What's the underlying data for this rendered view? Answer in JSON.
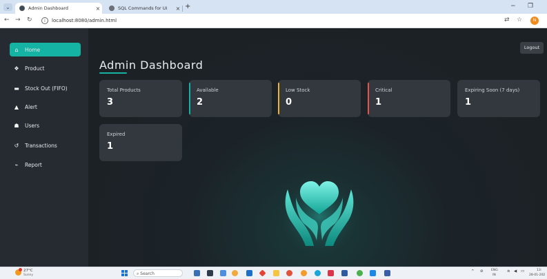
{
  "browser": {
    "tabs": [
      {
        "title": "Admin Dashboard",
        "active": true
      },
      {
        "title": "SQL Commands for UI",
        "active": false
      }
    ],
    "url": "localhost:8080/admin.html"
  },
  "sidebar": {
    "items": [
      {
        "label": "Home",
        "icon": "home-icon",
        "glyph": "⌂",
        "active": true
      },
      {
        "label": "Product",
        "icon": "product-icon",
        "glyph": "❖"
      },
      {
        "label": "Stock Out (FIFO)",
        "icon": "stock-out-icon",
        "glyph": "▬"
      },
      {
        "label": "Alert",
        "icon": "alert-icon",
        "glyph": "▲"
      },
      {
        "label": "Users",
        "icon": "users-icon",
        "glyph": "☗"
      },
      {
        "label": "Transactions",
        "icon": "history-icon",
        "glyph": "↺"
      },
      {
        "label": "Report",
        "icon": "report-icon",
        "glyph": "⌁"
      }
    ]
  },
  "header": {
    "title": "Admin Dashboard",
    "logout": "Logout"
  },
  "cards": [
    {
      "label": "Total Products",
      "value": "3",
      "accent": ""
    },
    {
      "label": "Available",
      "value": "2",
      "accent": "#14b3a3"
    },
    {
      "label": "Low Stock",
      "value": "0",
      "accent": "#f0b429"
    },
    {
      "label": "Critical",
      "value": "1",
      "accent": "#e5534b"
    },
    {
      "label": "Expiring Soon (7 days)",
      "value": "1",
      "accent": ""
    },
    {
      "label": "Expired",
      "value": "1",
      "accent": ""
    }
  ],
  "taskbar": {
    "temperature": "27°C",
    "condition": "Sunny",
    "search": "Search",
    "lang_top": "ENG",
    "lang_bottom": "IN",
    "time": "13:",
    "date": "28-01-202"
  },
  "colors": {
    "accent": "#14b3a3",
    "app_bg": "#1c2126",
    "sidebar_bg": "#262b31",
    "card_bg": "#33383e"
  }
}
